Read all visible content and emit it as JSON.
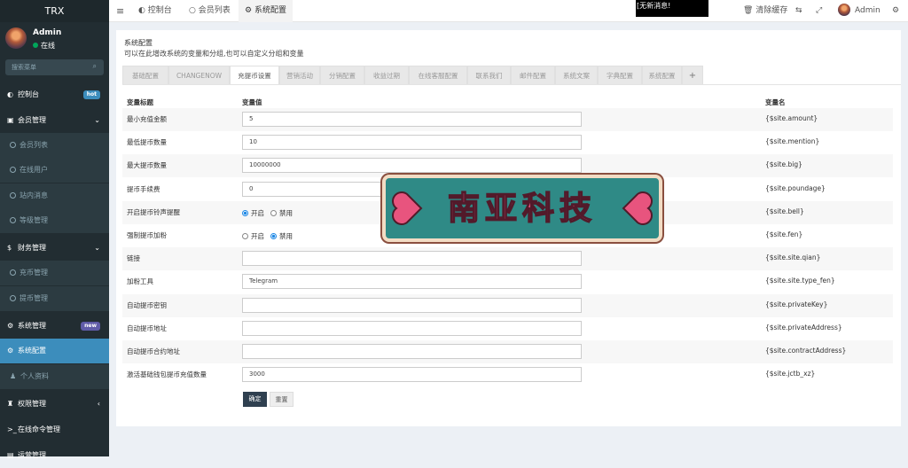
{
  "app": {
    "title": "TRX"
  },
  "user": {
    "name": "Admin",
    "status": "在线"
  },
  "search": {
    "placeholder": "搜索菜单"
  },
  "sidebar": {
    "items": [
      {
        "label": "控制台",
        "icon": "dashboard-icon",
        "badge": "hot",
        "badge_color": "#3c8dbc"
      },
      {
        "label": "会员管理",
        "icon": "users-icon"
      },
      {
        "label": "会员列表",
        "icon": "circle-icon"
      },
      {
        "label": "在线用户",
        "icon": "circle-icon"
      },
      {
        "label": "站内消息",
        "icon": "circle-icon"
      },
      {
        "label": "等级管理",
        "icon": "circle-icon"
      },
      {
        "label": "财务管理",
        "icon": "dollar-icon"
      },
      {
        "label": "充币管理",
        "icon": "circle-icon"
      },
      {
        "label": "提币管理",
        "icon": "circle-icon"
      },
      {
        "label": "系统管理",
        "icon": "cogs-icon",
        "badge": "new",
        "badge_color": "#605ca8"
      },
      {
        "label": "系统配置",
        "icon": "cog-icon"
      },
      {
        "label": "个人资料",
        "icon": "user-icon"
      },
      {
        "label": "权限管理",
        "icon": "group-icon"
      },
      {
        "label": "在线命令管理",
        "icon": "terminal-icon"
      },
      {
        "label": "运营管理",
        "icon": "file-icon"
      }
    ]
  },
  "topbar": {
    "tabs": [
      "控制台",
      "会员列表",
      "系统配置"
    ],
    "notice": "[无新消息!",
    "clear_cache": "清除缓存",
    "user": "Admin"
  },
  "page": {
    "title": "系统配置",
    "description": "可以在此增改系统的变量和分组,也可以自定义分组和变量"
  },
  "config_tabs": [
    "基础配置",
    "CHANGENOW",
    "充提币设置",
    "营销活动",
    "分销配置",
    "收益过期",
    "在线客服配置",
    "联系我们",
    "邮件配置",
    "系统文案",
    "字典配置",
    "系统配置",
    "+"
  ],
  "table": {
    "headers": {
      "title": "变量标题",
      "value": "变量值",
      "name": "变量名"
    },
    "rows": [
      {
        "label": "最小充值金额",
        "type": "input",
        "value": "5",
        "var": "{$site.amount}"
      },
      {
        "label": "最低提币数量",
        "type": "input",
        "value": "10",
        "var": "{$site.mention}"
      },
      {
        "label": "最大提币数量",
        "type": "input",
        "value": "10000000",
        "var": "{$site.big}"
      },
      {
        "label": "提币手续费",
        "type": "input",
        "value": "0",
        "var": "{$site.poundage}"
      },
      {
        "label": "开启提币铃声提醒",
        "type": "radio",
        "options": [
          "开启",
          "禁用"
        ],
        "selected": 0,
        "var": "{$site.bell}"
      },
      {
        "label": "强制提币加粉",
        "type": "radio",
        "options": [
          "开启",
          "禁用"
        ],
        "selected": 1,
        "var": "{$site.fen}"
      },
      {
        "label": "链接",
        "type": "input",
        "value": "",
        "var": "{$site.site.qian}"
      },
      {
        "label": "加粉工具",
        "type": "input",
        "value": "Telegram",
        "var": "{$site.site.type_fen}"
      },
      {
        "label": "自动提币密钥",
        "type": "input",
        "value": "",
        "var": "{$site.privateKey}"
      },
      {
        "label": "自动提币地址",
        "type": "input",
        "value": "",
        "var": "{$site.privateAddress}"
      },
      {
        "label": "自动提币合约地址",
        "type": "input",
        "value": "",
        "var": "{$site.contractAddress}"
      },
      {
        "label": "激活基础钱包提币充值数量",
        "type": "input",
        "value": "3000",
        "var": "{$site.jctb_xz}"
      }
    ]
  },
  "buttons": {
    "confirm": "确定",
    "reset": "重置"
  },
  "watermark": {
    "text": "南亚科技"
  },
  "colors": {
    "sidebar_bg": "#222d32",
    "active": "#3c8dbc",
    "confirm_btn": "#2f4050"
  }
}
